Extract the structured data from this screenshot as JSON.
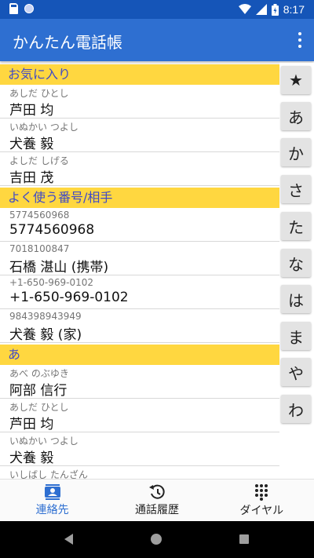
{
  "status_bar": {
    "time": "8:17"
  },
  "app_bar": {
    "title": "かんたん電話帳",
    "menu_icon": "overflow-menu-icon"
  },
  "sections": [
    {
      "header": "お気に入り",
      "rows": [
        {
          "reading": "あしだ ひとし",
          "name": "芦田 均"
        },
        {
          "reading": "いぬかい つよし",
          "name": "犬養 毅"
        },
        {
          "reading": "よしだ しげる",
          "name": "吉田 茂"
        }
      ]
    },
    {
      "header": "よく使う番号/相手",
      "rows": [
        {
          "reading": "5774560968",
          "name": "5774560968"
        },
        {
          "reading": "7018100847",
          "name": "石橋 湛山 (携帯)"
        },
        {
          "reading": "+1-650-969-0102",
          "name": "+1-650-969-0102"
        },
        {
          "reading": "984398943949",
          "name": "犬養 毅 (家)"
        }
      ]
    },
    {
      "header": "あ",
      "rows": [
        {
          "reading": "あべ のぶゆき",
          "name": "阿部 信行"
        },
        {
          "reading": "あしだ ひとし",
          "name": "芦田 均"
        },
        {
          "reading": "いぬかい つよし",
          "name": "犬養 毅"
        },
        {
          "reading": "いしばし たんざん",
          "name": ""
        }
      ]
    }
  ],
  "index": [
    "★",
    "あ",
    "か",
    "さ",
    "た",
    "な",
    "は",
    "ま",
    "や",
    "わ"
  ],
  "bottom_nav": {
    "contacts": {
      "label": "連絡先",
      "icon": "contacts-icon"
    },
    "history": {
      "label": "通話履歴",
      "icon": "history-icon"
    },
    "dial": {
      "label": "ダイヤル",
      "icon": "dialpad-icon"
    }
  },
  "colors": {
    "status_bar": "#1555b8",
    "app_bar": "#2e6fd1",
    "section_header_bg": "#ffd740",
    "section_header_text": "#3f4ac7",
    "active_tab": "#2e6fd1"
  }
}
